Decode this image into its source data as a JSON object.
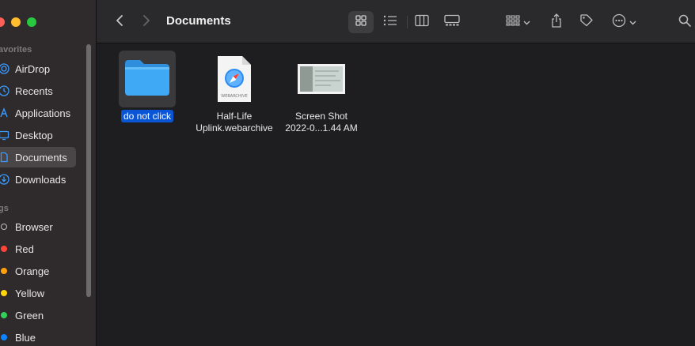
{
  "window": {
    "title": "Documents"
  },
  "sidebar": {
    "favorites_header": "avorites",
    "favorites": [
      {
        "label": "AirDrop",
        "icon": "airdrop-icon"
      },
      {
        "label": "Recents",
        "icon": "clock-icon"
      },
      {
        "label": "Applications",
        "icon": "applications-icon"
      },
      {
        "label": "Desktop",
        "icon": "desktop-icon"
      },
      {
        "label": "Documents",
        "icon": "document-icon",
        "active": true
      },
      {
        "label": "Downloads",
        "icon": "download-icon"
      }
    ],
    "tags_header": "gs",
    "tags": [
      {
        "label": "Browser",
        "color": ""
      },
      {
        "label": "Red",
        "color": "#ff453a"
      },
      {
        "label": "Orange",
        "color": "#ff9f0a"
      },
      {
        "label": "Yellow",
        "color": "#ffd60a"
      },
      {
        "label": "Green",
        "color": "#30d158"
      },
      {
        "label": "Blue",
        "color": "#0a84ff"
      }
    ]
  },
  "files": [
    {
      "name": "do not click",
      "kind": "folder",
      "selected": true
    },
    {
      "name_line1": "Half-Life",
      "name_line2": "Uplink.webarchive",
      "kind": "webarchive",
      "badge": "WEBARCHIVE"
    },
    {
      "name_line1": "Screen Shot",
      "name_line2": "2022-0...1.44 AM",
      "kind": "image"
    }
  ],
  "colors": {
    "accent": "#0a55d6",
    "folder": "#3fa9f5"
  }
}
